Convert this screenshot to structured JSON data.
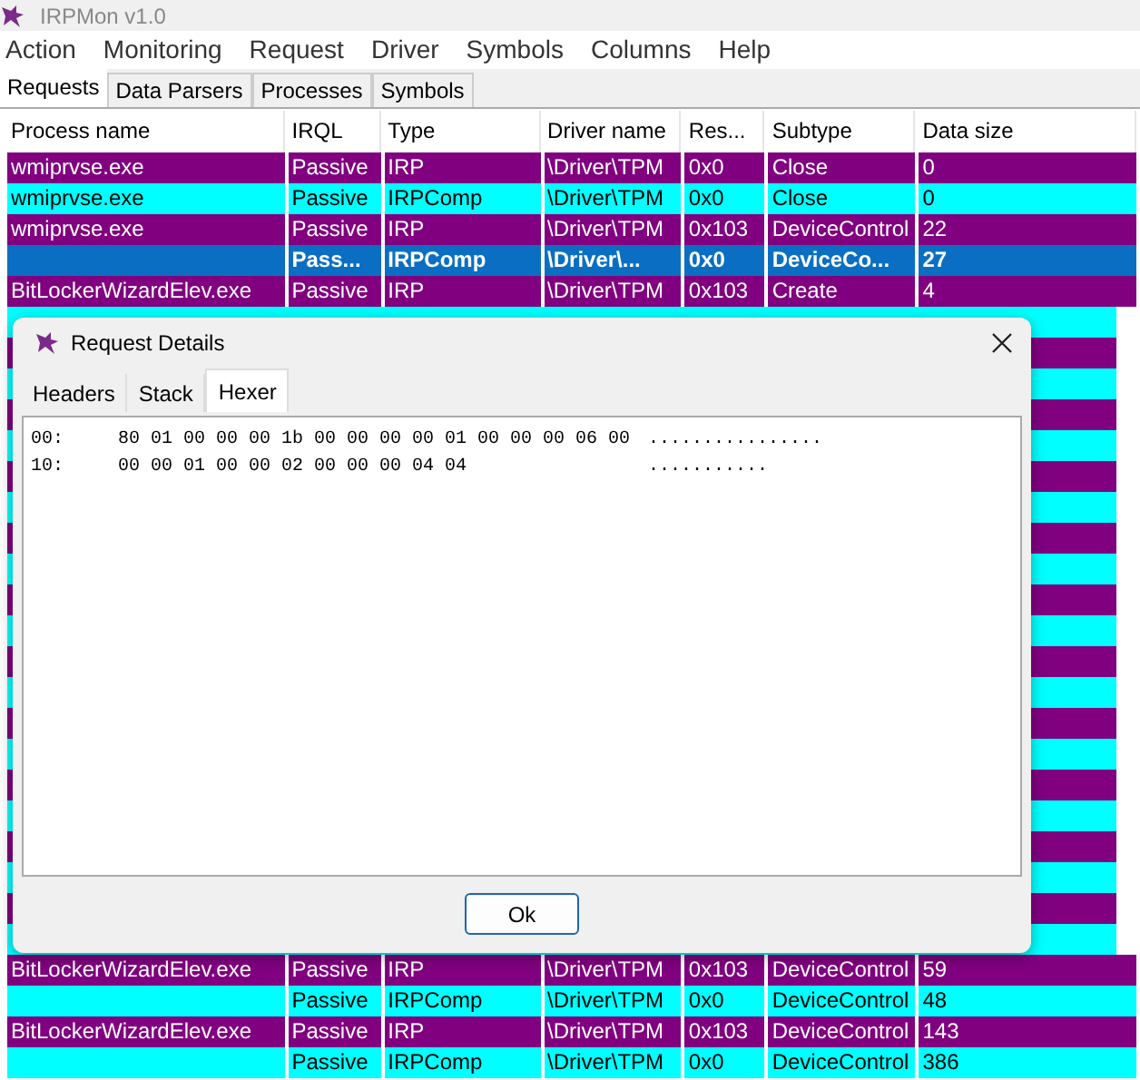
{
  "window": {
    "title": "IRPMon v1.0"
  },
  "menu": [
    "Action",
    "Monitoring",
    "Request",
    "Driver",
    "Symbols",
    "Columns",
    "Help"
  ],
  "tabs": [
    {
      "label": "Requests",
      "selected": true
    },
    {
      "label": "Data Parsers",
      "selected": false
    },
    {
      "label": "Processes",
      "selected": false
    },
    {
      "label": "Symbols",
      "selected": false
    }
  ],
  "table": {
    "columns": [
      "Process name",
      "IRQL",
      "Type",
      "Driver name",
      "Res...",
      "Subtype",
      "Data size"
    ],
    "rows_top": [
      {
        "cells": [
          "wmiprvse.exe",
          "Passive",
          "IRP",
          "\\Driver\\TPM",
          "0x0",
          "Close",
          "0"
        ],
        "color": "#800080",
        "selected": false
      },
      {
        "cells": [
          "wmiprvse.exe",
          "Passive",
          "IRPComp",
          "\\Driver\\TPM",
          "0x0",
          "Close",
          "0"
        ],
        "color": "#00ffff",
        "selected": false
      },
      {
        "cells": [
          "wmiprvse.exe",
          "Passive",
          "IRP",
          "\\Driver\\TPM",
          "0x103",
          "DeviceControl",
          "22"
        ],
        "color": "#800080",
        "selected": false
      },
      {
        "cells": [
          "",
          "Pass...",
          "IRPComp",
          "\\Driver\\...",
          "0x0",
          "DeviceCo...",
          "27"
        ],
        "color": "#0a6fc2",
        "selected": true
      },
      {
        "cells": [
          "BitLockerWizardElev.exe",
          "Passive",
          "IRP",
          "\\Driver\\TPM",
          "0x103",
          "Create",
          "4"
        ],
        "color": "#800080",
        "selected": false
      }
    ],
    "rows_behind_dialog": [
      {
        "color": "#00ffff"
      },
      {
        "color": "#800080"
      },
      {
        "color": "#00ffff"
      },
      {
        "color": "#800080"
      },
      {
        "color": "#00ffff"
      },
      {
        "color": "#800080"
      },
      {
        "color": "#00ffff"
      },
      {
        "color": "#800080"
      },
      {
        "color": "#00ffff"
      },
      {
        "color": "#800080"
      },
      {
        "color": "#00ffff"
      },
      {
        "color": "#800080"
      },
      {
        "color": "#00ffff"
      },
      {
        "color": "#800080"
      },
      {
        "color": "#00ffff"
      },
      {
        "color": "#800080"
      },
      {
        "color": "#00ffff"
      },
      {
        "color": "#800080"
      },
      {
        "color": "#00ffff"
      },
      {
        "color": "#800080"
      },
      {
        "color": "#00ffff"
      }
    ],
    "rows_bottom": [
      {
        "cells": [
          "BitLockerWizardElev.exe",
          "Passive",
          "IRP",
          "\\Driver\\TPM",
          "0x103",
          "DeviceControl",
          "59"
        ],
        "color": "#800080",
        "selected": false
      },
      {
        "cells": [
          "",
          "Passive",
          "IRPComp",
          "\\Driver\\TPM",
          "0x0",
          "DeviceControl",
          "48"
        ],
        "color": "#00ffff",
        "selected": false
      },
      {
        "cells": [
          "BitLockerWizardElev.exe",
          "Passive",
          "IRP",
          "\\Driver\\TPM",
          "0x103",
          "DeviceControl",
          "143"
        ],
        "color": "#800080",
        "selected": false
      },
      {
        "cells": [
          "",
          "Passive",
          "IRPComp",
          "\\Driver\\TPM",
          "0x0",
          "DeviceControl",
          "386"
        ],
        "color": "#00ffff",
        "selected": false
      }
    ]
  },
  "dialog": {
    "title": "Request Details",
    "tabs": [
      {
        "label": "Headers",
        "selected": false
      },
      {
        "label": "Stack",
        "selected": false
      },
      {
        "label": "Hexer",
        "selected": true
      }
    ],
    "hex_lines": [
      {
        "offset": "00:",
        "bytes": "80 01 00 00 00 1b 00 00 00 00 01 00 00 00 06 00",
        "ascii": "................"
      },
      {
        "offset": "10:",
        "bytes": "00 00 01 00 00 02 00 00 00 04 04",
        "ascii": "..........."
      }
    ],
    "button": "Ok"
  }
}
